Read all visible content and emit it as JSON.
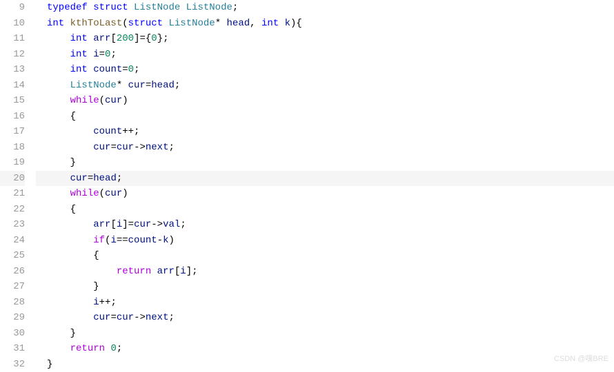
{
  "lineStart": 9,
  "highlightLine": 20,
  "watermark": "CSDN @嘿BRE",
  "code": [
    {
      "indent": 0,
      "tokens": [
        {
          "t": "kw",
          "v": "typedef"
        },
        {
          "t": "sp",
          "v": " "
        },
        {
          "t": "kw",
          "v": "struct"
        },
        {
          "t": "sp",
          "v": " "
        },
        {
          "t": "type",
          "v": "ListNode"
        },
        {
          "t": "sp",
          "v": " "
        },
        {
          "t": "type",
          "v": "ListNode"
        },
        {
          "t": "punct",
          "v": ";"
        }
      ]
    },
    {
      "indent": 0,
      "tokens": [
        {
          "t": "kw",
          "v": "int"
        },
        {
          "t": "sp",
          "v": " "
        },
        {
          "t": "func",
          "v": "kthToLast"
        },
        {
          "t": "paren",
          "v": "("
        },
        {
          "t": "kw",
          "v": "struct"
        },
        {
          "t": "sp",
          "v": " "
        },
        {
          "t": "type",
          "v": "ListNode"
        },
        {
          "t": "op",
          "v": "*"
        },
        {
          "t": "sp",
          "v": " "
        },
        {
          "t": "var",
          "v": "head"
        },
        {
          "t": "punct",
          "v": ","
        },
        {
          "t": "sp",
          "v": " "
        },
        {
          "t": "kw",
          "v": "int"
        },
        {
          "t": "sp",
          "v": " "
        },
        {
          "t": "var",
          "v": "k"
        },
        {
          "t": "paren",
          "v": ")"
        },
        {
          "t": "brace",
          "v": "{"
        }
      ]
    },
    {
      "indent": 1,
      "tokens": [
        {
          "t": "kw",
          "v": "int"
        },
        {
          "t": "sp",
          "v": " "
        },
        {
          "t": "var",
          "v": "arr"
        },
        {
          "t": "paren",
          "v": "["
        },
        {
          "t": "num",
          "v": "200"
        },
        {
          "t": "paren",
          "v": "]"
        },
        {
          "t": "op",
          "v": "="
        },
        {
          "t": "brace",
          "v": "{"
        },
        {
          "t": "num",
          "v": "0"
        },
        {
          "t": "brace",
          "v": "}"
        },
        {
          "t": "punct",
          "v": ";"
        }
      ]
    },
    {
      "indent": 1,
      "tokens": [
        {
          "t": "kw",
          "v": "int"
        },
        {
          "t": "sp",
          "v": " "
        },
        {
          "t": "var",
          "v": "i"
        },
        {
          "t": "op",
          "v": "="
        },
        {
          "t": "num",
          "v": "0"
        },
        {
          "t": "punct",
          "v": ";"
        }
      ]
    },
    {
      "indent": 1,
      "tokens": [
        {
          "t": "kw",
          "v": "int"
        },
        {
          "t": "sp",
          "v": " "
        },
        {
          "t": "var",
          "v": "count"
        },
        {
          "t": "op",
          "v": "="
        },
        {
          "t": "num",
          "v": "0"
        },
        {
          "t": "punct",
          "v": ";"
        }
      ]
    },
    {
      "indent": 1,
      "tokens": [
        {
          "t": "type",
          "v": "ListNode"
        },
        {
          "t": "op",
          "v": "*"
        },
        {
          "t": "sp",
          "v": " "
        },
        {
          "t": "var",
          "v": "cur"
        },
        {
          "t": "op",
          "v": "="
        },
        {
          "t": "var",
          "v": "head"
        },
        {
          "t": "punct",
          "v": ";"
        }
      ]
    },
    {
      "indent": 1,
      "tokens": [
        {
          "t": "ctrl",
          "v": "while"
        },
        {
          "t": "paren",
          "v": "("
        },
        {
          "t": "var",
          "v": "cur"
        },
        {
          "t": "paren",
          "v": ")"
        }
      ]
    },
    {
      "indent": 1,
      "tokens": [
        {
          "t": "brace",
          "v": "{"
        }
      ]
    },
    {
      "indent": 2,
      "tokens": [
        {
          "t": "var",
          "v": "count"
        },
        {
          "t": "op",
          "v": "++"
        },
        {
          "t": "punct",
          "v": ";"
        }
      ]
    },
    {
      "indent": 2,
      "tokens": [
        {
          "t": "var",
          "v": "cur"
        },
        {
          "t": "op",
          "v": "="
        },
        {
          "t": "var",
          "v": "cur"
        },
        {
          "t": "op",
          "v": "->"
        },
        {
          "t": "var",
          "v": "next"
        },
        {
          "t": "punct",
          "v": ";"
        }
      ]
    },
    {
      "indent": 1,
      "tokens": [
        {
          "t": "brace",
          "v": "}"
        }
      ]
    },
    {
      "indent": 1,
      "tokens": [
        {
          "t": "var",
          "v": "cur"
        },
        {
          "t": "op",
          "v": "="
        },
        {
          "t": "var",
          "v": "head"
        },
        {
          "t": "punct",
          "v": ";"
        }
      ]
    },
    {
      "indent": 1,
      "tokens": [
        {
          "t": "ctrl",
          "v": "while"
        },
        {
          "t": "paren",
          "v": "("
        },
        {
          "t": "var",
          "v": "cur"
        },
        {
          "t": "paren",
          "v": ")"
        }
      ]
    },
    {
      "indent": 1,
      "tokens": [
        {
          "t": "brace",
          "v": "{"
        }
      ]
    },
    {
      "indent": 2,
      "tokens": [
        {
          "t": "var",
          "v": "arr"
        },
        {
          "t": "paren",
          "v": "["
        },
        {
          "t": "var",
          "v": "i"
        },
        {
          "t": "paren",
          "v": "]"
        },
        {
          "t": "op",
          "v": "="
        },
        {
          "t": "var",
          "v": "cur"
        },
        {
          "t": "op",
          "v": "->"
        },
        {
          "t": "var",
          "v": "val"
        },
        {
          "t": "punct",
          "v": ";"
        }
      ]
    },
    {
      "indent": 2,
      "tokens": [
        {
          "t": "ctrl",
          "v": "if"
        },
        {
          "t": "paren",
          "v": "("
        },
        {
          "t": "var",
          "v": "i"
        },
        {
          "t": "op",
          "v": "=="
        },
        {
          "t": "var",
          "v": "count"
        },
        {
          "t": "op",
          "v": "-"
        },
        {
          "t": "var",
          "v": "k"
        },
        {
          "t": "paren",
          "v": ")"
        }
      ]
    },
    {
      "indent": 2,
      "tokens": [
        {
          "t": "brace",
          "v": "{"
        }
      ]
    },
    {
      "indent": 3,
      "tokens": [
        {
          "t": "ctrl",
          "v": "return"
        },
        {
          "t": "sp",
          "v": " "
        },
        {
          "t": "var",
          "v": "arr"
        },
        {
          "t": "paren",
          "v": "["
        },
        {
          "t": "var",
          "v": "i"
        },
        {
          "t": "paren",
          "v": "]"
        },
        {
          "t": "punct",
          "v": ";"
        }
      ]
    },
    {
      "indent": 2,
      "tokens": [
        {
          "t": "brace",
          "v": "}"
        }
      ]
    },
    {
      "indent": 2,
      "tokens": [
        {
          "t": "var",
          "v": "i"
        },
        {
          "t": "op",
          "v": "++"
        },
        {
          "t": "punct",
          "v": ";"
        }
      ]
    },
    {
      "indent": 2,
      "tokens": [
        {
          "t": "var",
          "v": "cur"
        },
        {
          "t": "op",
          "v": "="
        },
        {
          "t": "var",
          "v": "cur"
        },
        {
          "t": "op",
          "v": "->"
        },
        {
          "t": "var",
          "v": "next"
        },
        {
          "t": "punct",
          "v": ";"
        }
      ]
    },
    {
      "indent": 1,
      "tokens": [
        {
          "t": "brace",
          "v": "}"
        }
      ]
    },
    {
      "indent": 1,
      "tokens": [
        {
          "t": "ctrl",
          "v": "return"
        },
        {
          "t": "sp",
          "v": " "
        },
        {
          "t": "num",
          "v": "0"
        },
        {
          "t": "punct",
          "v": ";"
        }
      ]
    },
    {
      "indent": 0,
      "tokens": [
        {
          "t": "brace",
          "v": "}"
        }
      ]
    }
  ]
}
